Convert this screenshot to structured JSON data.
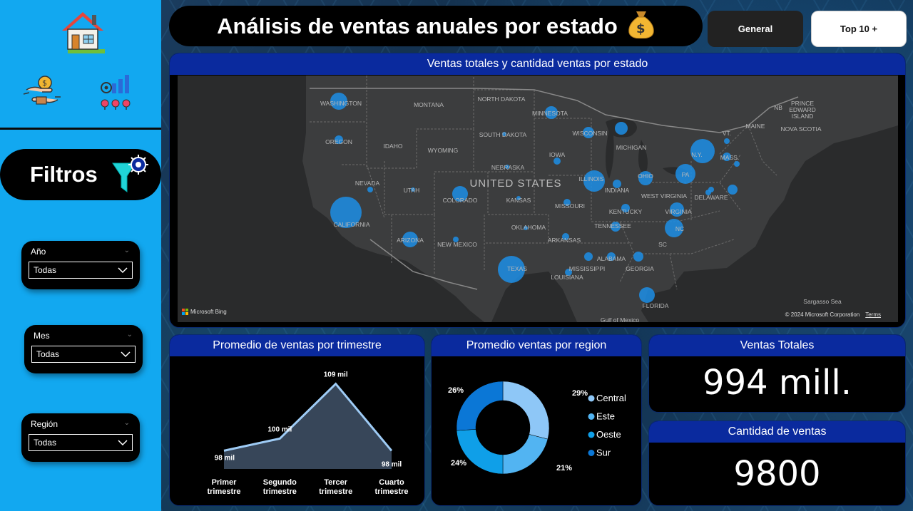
{
  "header": {
    "title": "Análisis de ventas anuales por estado",
    "buttons": [
      "General",
      "Top 10 +"
    ]
  },
  "sidebar": {
    "filters_label": "Filtros",
    "slicers": [
      {
        "label": "Año",
        "value": "Todas"
      },
      {
        "label": "Mes",
        "value": "Todas"
      },
      {
        "label": "Región",
        "value": "Todas"
      }
    ],
    "icons": [
      "house-icon",
      "money-exchange-icon",
      "analytics-people-icon",
      "filter-gear-icon"
    ]
  },
  "map": {
    "title": "Ventas totales y cantidad ventas por estado",
    "country_label": "UNITED STATES",
    "labels": [
      "WASHINGTON",
      "MONTANA",
      "NORTH DAKOTA",
      "MINNESOTA",
      "OREGON",
      "IDAHO",
      "WYOMING",
      "SOUTH DAKOTA",
      "WISCONSIN",
      "MICHIGAN",
      "IOWA",
      "NEBRASKA",
      "NEVADA",
      "UTAH",
      "COLORADO",
      "KANSAS",
      "MISSOURI",
      "ILLINOIS",
      "INDIANA",
      "OHIO",
      "PA",
      "N.Y.",
      "MASS.",
      "VT.",
      "MAINE",
      "CALIFORNIA",
      "ARIZONA",
      "NEW MEXICO",
      "OKLAHOMA",
      "ARKANSAS",
      "TENNESSEE",
      "KENTUCKY",
      "WEST VIRGINIA",
      "VIRGINIA",
      "NC",
      "SC",
      "MISSISSIPPI",
      "ALABAMA",
      "GEORGIA",
      "LOUISIANA",
      "TEXAS",
      "FLORIDA",
      "DELAWARE",
      "NB",
      "PRINCE EDWARD ISLAND",
      "NOVA SCOTIA",
      "Sargasso Sea",
      "Gulf of Mexico"
    ],
    "attribution": "© 2024 Microsoft Corporation",
    "terms": "Terms",
    "bing_logo": "Microsoft Bing"
  },
  "trimestre_chart": {
    "title": "Promedio de ventas por trimestre",
    "categories": [
      "Primer trimestre",
      "Segundo trimestre",
      "Tercer trimestre",
      "Cuarto trimestre"
    ],
    "category_lines": [
      [
        "Primer",
        "trimestre"
      ],
      [
        "Segundo",
        "trimestre"
      ],
      [
        "Tercer",
        "trimestre"
      ],
      [
        "Cuarto",
        "trimestre"
      ]
    ],
    "values": [
      98,
      100,
      109,
      98
    ],
    "value_labels": [
      "98 mil",
      "100 mil",
      "109 mil",
      "98 mil"
    ]
  },
  "region_chart": {
    "title": "Promedio ventas por region",
    "legend": [
      "Central",
      "Este",
      "Oeste",
      "Sur"
    ],
    "values": [
      29,
      21,
      24,
      26
    ],
    "value_labels": [
      "29%",
      "21%",
      "24%",
      "26%"
    ],
    "colors": [
      "#8ec7f7",
      "#52b4f2",
      "#0f9fe8",
      "#0b77d6"
    ]
  },
  "kpis": {
    "ventas_totales": {
      "title": "Ventas Totales",
      "value": "994 mill."
    },
    "cantidad_ventas": {
      "title": "Cantidad de ventas",
      "value": "9800"
    }
  },
  "chart_data": [
    {
      "type": "area",
      "title": "Promedio de ventas por trimestre",
      "categories": [
        "Primer trimestre",
        "Segundo trimestre",
        "Tercer trimestre",
        "Cuarto trimestre"
      ],
      "series": [
        {
          "values": [
            98,
            100,
            109,
            98
          ]
        }
      ],
      "ylabel": "",
      "xlabel": ""
    },
    {
      "type": "pie",
      "title": "Promedio ventas por region",
      "categories": [
        "Central",
        "Este",
        "Oeste",
        "Sur"
      ],
      "values": [
        29,
        21,
        24,
        26
      ]
    }
  ]
}
